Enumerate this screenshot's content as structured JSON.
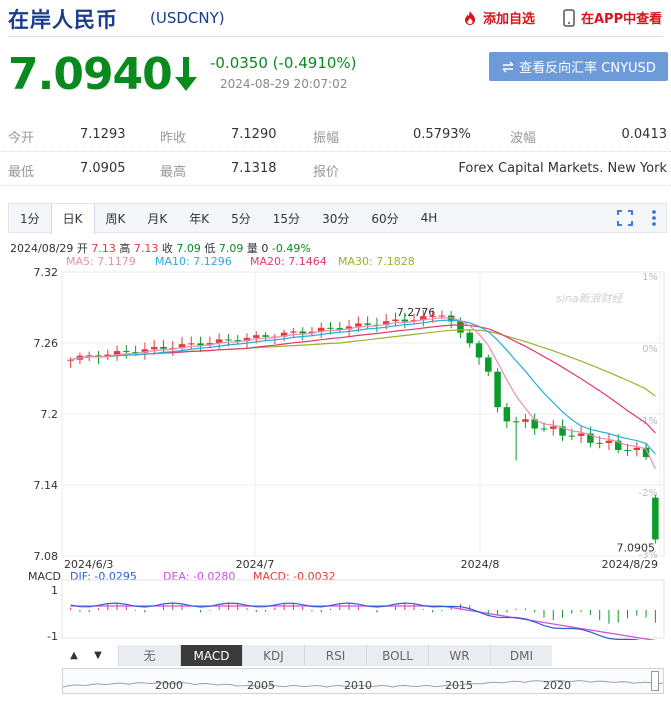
{
  "header": {
    "title": "在岸人民币",
    "code": "(USDCNY)",
    "favorite_label": "添加自选",
    "app_label": "在APP中查看"
  },
  "quote": {
    "price": "7.0940",
    "change": "-0.0350 (-0.4910%)",
    "time": "2024-08-29 20:07:02",
    "reverse_button": "查看反向汇率 CNYUSD"
  },
  "stats": {
    "row1": [
      {
        "label": "今开",
        "value": "7.1293"
      },
      {
        "label": "昨收",
        "value": "7.1290"
      },
      {
        "label": "振幅",
        "value": "0.5793%"
      },
      {
        "label": "波幅",
        "value": "0.0413"
      }
    ],
    "row2": [
      {
        "label": "最低",
        "value": "7.0905"
      },
      {
        "label": "最高",
        "value": "7.1318"
      },
      {
        "label": "报价",
        "value": "Forex Capital Markets. New York"
      }
    ]
  },
  "tabs": [
    "1分",
    "日K",
    "周K",
    "月K",
    "年K",
    "5分",
    "15分",
    "30分",
    "60分",
    "4H"
  ],
  "active_tab": "日K",
  "chart_info": {
    "date": "2024/08/29",
    "open_label": "开",
    "open": "7.13",
    "high_label": "高",
    "high": "7.13",
    "close_label": "收",
    "close": "7.09",
    "low_label": "低",
    "low": "7.09",
    "vol_label": "量",
    "vol": "0",
    "pct": "-0.49%",
    "ma5": "MA5: 7.1179",
    "ma10": "MA10: 7.1296",
    "ma20": "MA20: 7.1464",
    "ma30": "MA30: 7.1828",
    "macd_title": "MACD",
    "dif": "DIF: -0.0295",
    "dea": "DEA: -0.0280",
    "macd": "MACD: -0.0032",
    "watermark": "sina新浪财经"
  },
  "chart_data": {
    "type": "candlestick",
    "y_ticks": [
      "7.32",
      "7.26",
      "7.2",
      "7.14",
      "7.08"
    ],
    "pct_ticks": [
      "1%",
      "0%",
      "-1%",
      "-2%",
      "-3%"
    ],
    "x_ticks": [
      "2024/6/3",
      "2024/7",
      "2024/8",
      "2024/8/29"
    ],
    "high_label": "7.2776",
    "low_label": "7.0905",
    "ylim": [
      7.08,
      7.32
    ],
    "macd_ticks": [
      "1",
      "-1"
    ],
    "colors": {
      "up": "#e23a3a",
      "down": "#0a9b2a",
      "ma5": "#e88fb0",
      "ma10": "#25aee0",
      "ma20": "#e23a6e",
      "ma30": "#9ab22a",
      "dif": "#2f5fd6",
      "dea": "#d24fe0"
    }
  },
  "indicators": [
    "无",
    "MACD",
    "KDJ",
    "RSI",
    "BOLL",
    "WR",
    "DMI"
  ],
  "active_indicator": "MACD",
  "overview_years": [
    "2000",
    "2005",
    "2010",
    "2015",
    "2020"
  ]
}
